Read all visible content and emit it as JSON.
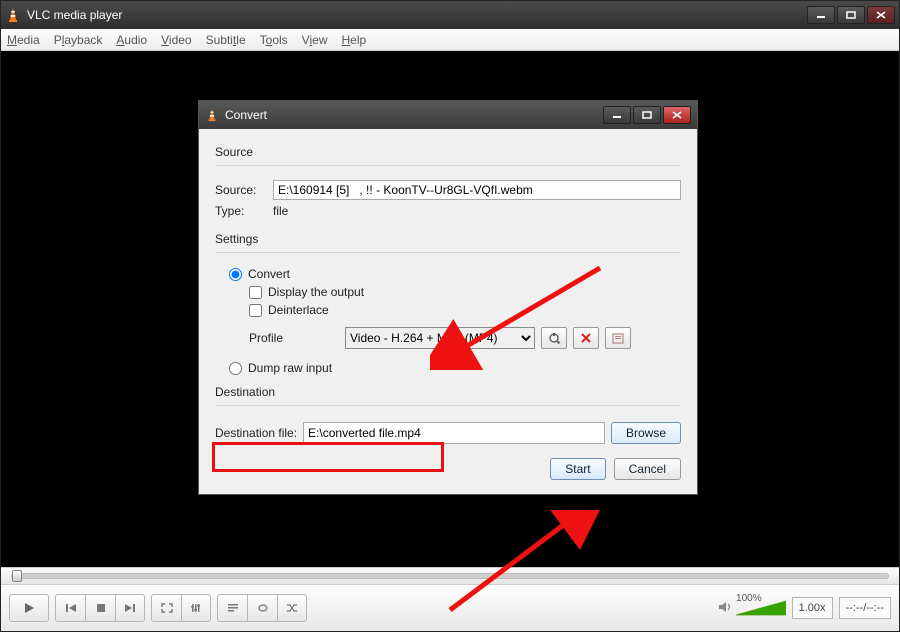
{
  "main_window": {
    "title": "VLC media player",
    "menu": {
      "media": "Media",
      "playback": "Playback",
      "audio": "Audio",
      "video": "Video",
      "subtitle": "Subtitle",
      "tools": "Tools",
      "view": "View",
      "help": "Help"
    }
  },
  "controls": {
    "volume_pct": "100%",
    "speed": "1.00x",
    "time": "--:--/--:--"
  },
  "dialog": {
    "title": "Convert",
    "source_section": "Source",
    "source_label": "Source:",
    "source_value": "E:\\160914 [5]   , !! - KoonTV--Ur8GL-VQfI.webm",
    "type_label": "Type:",
    "type_value": "file",
    "settings_section": "Settings",
    "convert_radio": "Convert",
    "display_output": "Display the output",
    "deinterlace": "Deinterlace",
    "profile_label": "Profile",
    "profile_value": "Video - H.264 + MP3 (MP4)",
    "dump_raw": "Dump raw input",
    "destination_section": "Destination",
    "dest_label": "Destination file:",
    "dest_value": "E:\\converted file.mp4",
    "browse": "Browse",
    "start": "Start",
    "cancel": "Cancel"
  }
}
